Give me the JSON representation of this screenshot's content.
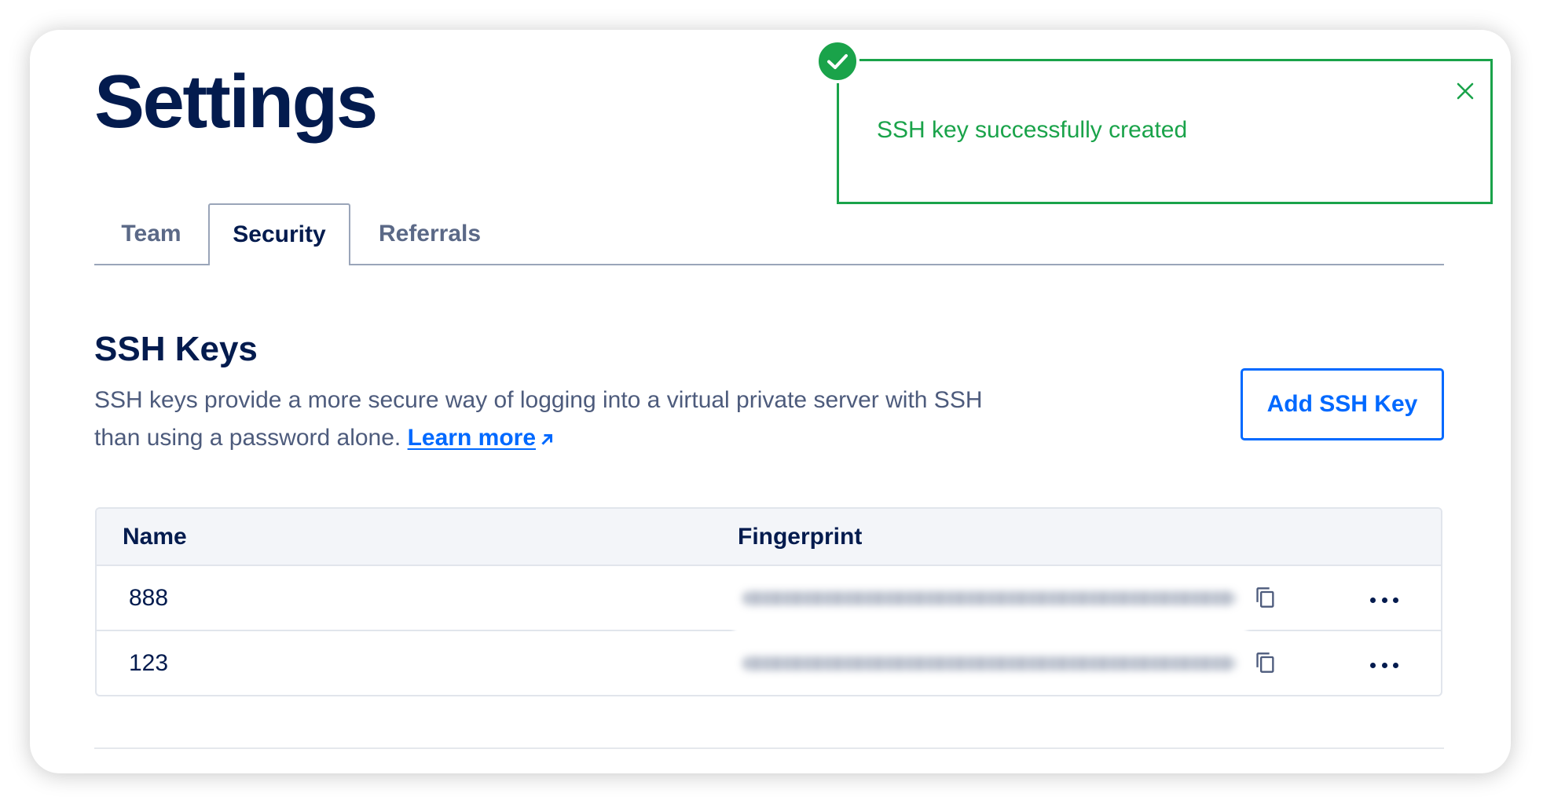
{
  "page": {
    "title": "Settings"
  },
  "tabs": [
    {
      "label": "Team",
      "active": false
    },
    {
      "label": "Security",
      "active": true
    },
    {
      "label": "Referrals",
      "active": false
    }
  ],
  "toast": {
    "message": "SSH key successfully created",
    "icon": "check-circle-icon",
    "close_icon": "close-icon"
  },
  "ssh_keys": {
    "heading": "SSH Keys",
    "description": "SSH keys provide a more secure way of logging into a virtual private server with SSH than using a password alone.",
    "learn_more": {
      "label": "Learn more",
      "icon": "arrow-up-right-icon"
    },
    "add_button": "Add SSH Key",
    "table": {
      "columns": [
        "Name",
        "Fingerprint"
      ],
      "rows": [
        {
          "name": "888",
          "fingerprint_blurred": true,
          "copy_icon": "copy-icon",
          "menu_icon": "more-horizontal-icon"
        },
        {
          "name": "123",
          "fingerprint_blurred": true,
          "copy_icon": "copy-icon",
          "menu_icon": "more-horizontal-icon"
        }
      ]
    }
  },
  "colors": {
    "primary_text": "#031b4e",
    "secondary_text": "#4d5b7c",
    "accent": "#0069ff",
    "success": "#1aa34a",
    "table_header_bg": "#f3f5f9",
    "border": "#e1e5ec"
  }
}
